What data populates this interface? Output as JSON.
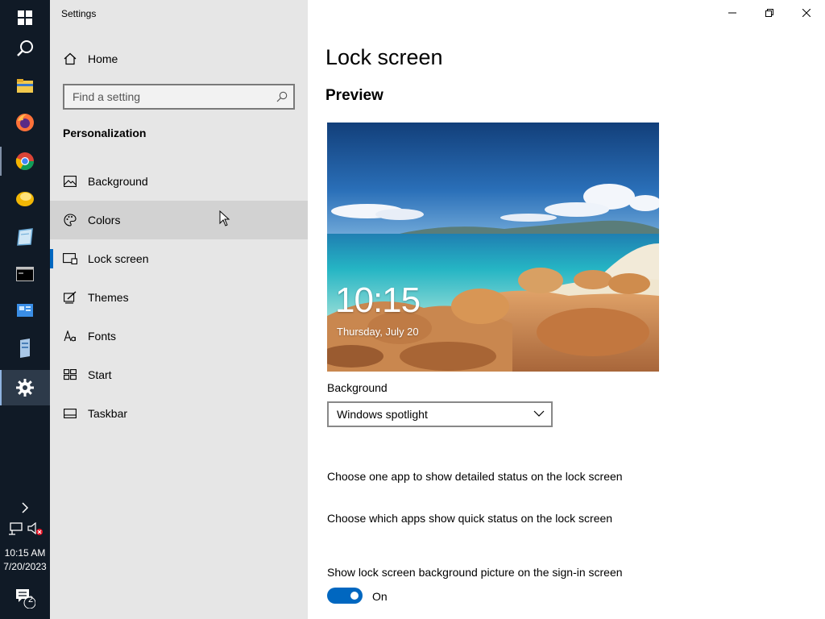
{
  "window": {
    "title": "Settings"
  },
  "window_controls": {
    "minimize": "minimize-icon",
    "restore": "restore-icon",
    "close": "close-icon"
  },
  "taskbar": {
    "items": [
      {
        "name": "windows-start",
        "icon": "windows-logo-icon"
      },
      {
        "name": "search",
        "icon": "search-icon"
      },
      {
        "name": "file-explorer",
        "icon": "folder-icon"
      },
      {
        "name": "firefox",
        "icon": "firefox-icon"
      },
      {
        "name": "chrome",
        "icon": "chrome-icon"
      },
      {
        "name": "app-gold",
        "icon": "coin-app-icon"
      },
      {
        "name": "app-notepad",
        "icon": "notebook-icon"
      },
      {
        "name": "terminal",
        "icon": "terminal-icon"
      },
      {
        "name": "control-panel",
        "icon": "control-panel-icon"
      },
      {
        "name": "server",
        "icon": "server-icon"
      },
      {
        "name": "settings",
        "icon": "gear-icon",
        "active": true
      }
    ],
    "tray": {
      "time": "10:15 AM",
      "date": "7/20/2023",
      "notification_count": "2"
    }
  },
  "sidebar": {
    "home_label": "Home",
    "search_placeholder": "Find a setting",
    "section_title": "Personalization",
    "items": [
      {
        "label": "Background",
        "icon": "picture-icon"
      },
      {
        "label": "Colors",
        "icon": "palette-icon"
      },
      {
        "label": "Lock screen",
        "icon": "lock-screen-icon"
      },
      {
        "label": "Themes",
        "icon": "themes-icon"
      },
      {
        "label": "Fonts",
        "icon": "fonts-icon"
      },
      {
        "label": "Start",
        "icon": "start-icon"
      },
      {
        "label": "Taskbar",
        "icon": "taskbar-icon"
      }
    ],
    "selected_index": 2,
    "hover_index": 1
  },
  "main": {
    "title": "Lock screen",
    "preview_heading": "Preview",
    "preview_time": "10:15",
    "preview_date": "Thursday, July 20",
    "background_label": "Background",
    "background_value": "Windows spotlight",
    "detailed_status_text": "Choose one app to show detailed status on the lock screen",
    "quick_status_text": "Choose which apps show quick status on the lock screen",
    "signin_bg_text": "Show lock screen background picture on the sign-in screen",
    "toggle_state": "On"
  },
  "colors": {
    "accent": "#0067c0",
    "taskbar_bg": "#101a26",
    "sidebar_bg": "#e6e6e6"
  }
}
